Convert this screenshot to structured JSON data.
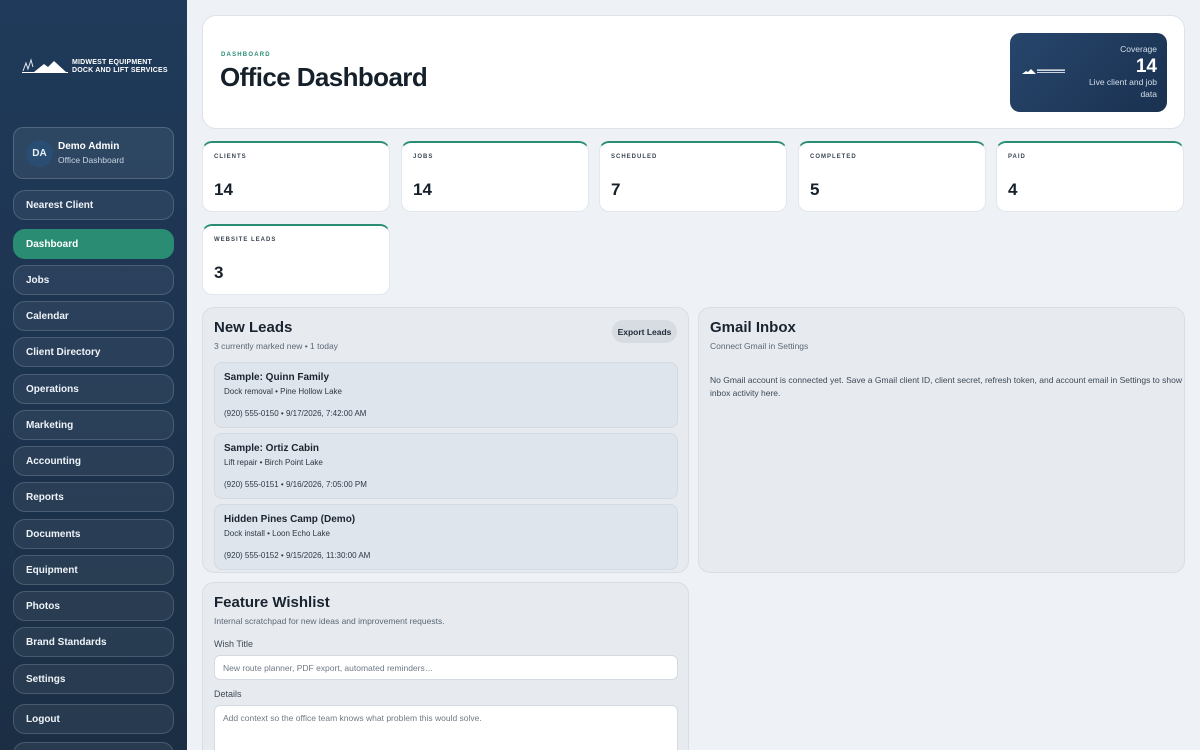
{
  "brand": {
    "line1": "MIDWEST EQUIPMENT",
    "line2": "DOCK AND LIFT SERVICES"
  },
  "user": {
    "initials": "DA",
    "name": "Demo Admin",
    "subtitle": "Office Dashboard"
  },
  "nav": [
    {
      "label": "Nearest Client",
      "active": false
    },
    {
      "label": "Dashboard",
      "active": true
    },
    {
      "label": "Jobs",
      "active": false
    },
    {
      "label": "Calendar",
      "active": false
    },
    {
      "label": "Client Directory",
      "active": false
    },
    {
      "label": "Operations",
      "active": false
    },
    {
      "label": "Marketing",
      "active": false
    },
    {
      "label": "Accounting",
      "active": false
    },
    {
      "label": "Reports",
      "active": false
    },
    {
      "label": "Documents",
      "active": false
    },
    {
      "label": "Equipment",
      "active": false
    },
    {
      "label": "Photos",
      "active": false
    },
    {
      "label": "Brand Standards",
      "active": false
    },
    {
      "label": "Settings",
      "active": false
    },
    {
      "label": "Logout",
      "active": false
    }
  ],
  "header": {
    "eyebrow": "DASHBOARD",
    "title": "Office Dashboard",
    "coverage_label": "Coverage",
    "coverage_value": "14",
    "coverage_sub": "Live client and job data"
  },
  "stats": [
    {
      "label": "CLIENTS",
      "value": "14"
    },
    {
      "label": "JOBS",
      "value": "14"
    },
    {
      "label": "SCHEDULED",
      "value": "7"
    },
    {
      "label": "COMPLETED",
      "value": "5"
    },
    {
      "label": "PAID",
      "value": "4"
    },
    {
      "label": "WEBSITE LEADS",
      "value": "3"
    }
  ],
  "leads": {
    "title": "New Leads",
    "subtitle": "3 currently marked new • 1 today",
    "export_label": "Export Leads",
    "items": [
      {
        "name": "Sample: Quinn Family",
        "meta": "Dock removal • Pine Hollow Lake",
        "contact": "(920) 555-0150 • 9/17/2026, 7:42:00 AM"
      },
      {
        "name": "Sample: Ortiz Cabin",
        "meta": "Lift repair • Birch Point Lake",
        "contact": "(920) 555-0151 • 9/16/2026, 7:05:00 PM"
      },
      {
        "name": "Hidden Pines Camp (Demo)",
        "meta": "Dock install • Loon Echo Lake",
        "contact": "(920) 555-0152 • 9/15/2026, 11:30:00 AM"
      }
    ]
  },
  "gmail": {
    "title": "Gmail Inbox",
    "subtitle": "Connect Gmail in Settings",
    "message": "No Gmail account is connected yet. Save a Gmail client ID, client secret, refresh token, and account email in Settings to show inbox activity here."
  },
  "wishlist": {
    "title": "Feature Wishlist",
    "subtitle": "Internal scratchpad for new ideas and improvement requests.",
    "wish_title_label": "Wish Title",
    "wish_title_placeholder": "New route planner, PDF export, automated reminders…",
    "details_label": "Details",
    "details_placeholder": "Add context so the office team knows what problem this would solve."
  },
  "colors": {
    "sidebar": "#1f3a5a",
    "accent": "#2a8d73",
    "background": "#eef1f5"
  }
}
